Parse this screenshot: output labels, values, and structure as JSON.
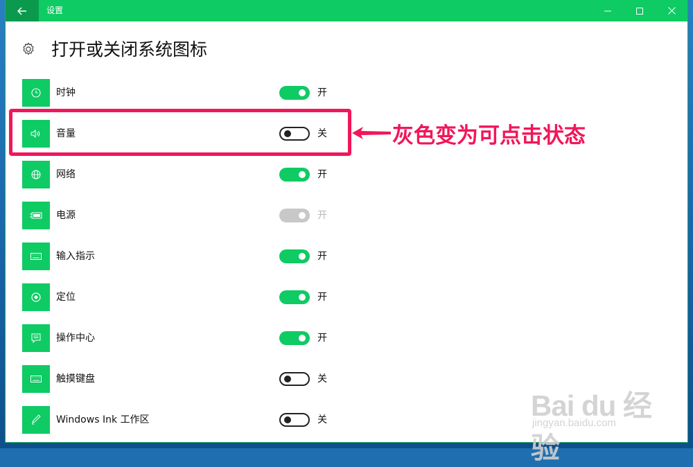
{
  "titlebar": {
    "title": "设置",
    "back_icon": "back-arrow-icon",
    "controls": [
      "minimize-icon",
      "maximize-icon",
      "close-icon"
    ]
  },
  "page": {
    "title": "打开或关闭系统图标",
    "icon": "gear-icon"
  },
  "colors": {
    "accent": "#0ecb64",
    "accent_dark": "#0b9a4d",
    "disabled": "#c8c8c8",
    "annotation": "#f1165a"
  },
  "items": [
    {
      "label": "时钟",
      "icon": "clock-icon",
      "state": "on",
      "state_label": "开"
    },
    {
      "label": "音量",
      "icon": "volume-icon",
      "state": "off",
      "state_label": "关"
    },
    {
      "label": "网络",
      "icon": "globe-icon",
      "state": "on",
      "state_label": "开"
    },
    {
      "label": "电源",
      "icon": "battery-icon",
      "state": "disabled",
      "state_label": "开"
    },
    {
      "label": "输入指示",
      "icon": "keyboard-icon",
      "state": "on",
      "state_label": "开"
    },
    {
      "label": "定位",
      "icon": "location-icon",
      "state": "on",
      "state_label": "开"
    },
    {
      "label": "操作中心",
      "icon": "action-center-icon",
      "state": "on",
      "state_label": "开"
    },
    {
      "label": "触摸键盘",
      "icon": "touch-keyboard-icon",
      "state": "off",
      "state_label": "关"
    },
    {
      "label": "Windows Ink 工作区",
      "icon": "pen-icon",
      "state": "off",
      "state_label": "关"
    }
  ],
  "annotation": {
    "text": "灰色变为可点击状态"
  },
  "watermark": {
    "logo": "Bai du 经验",
    "url": "jingyan.baidu.com"
  }
}
